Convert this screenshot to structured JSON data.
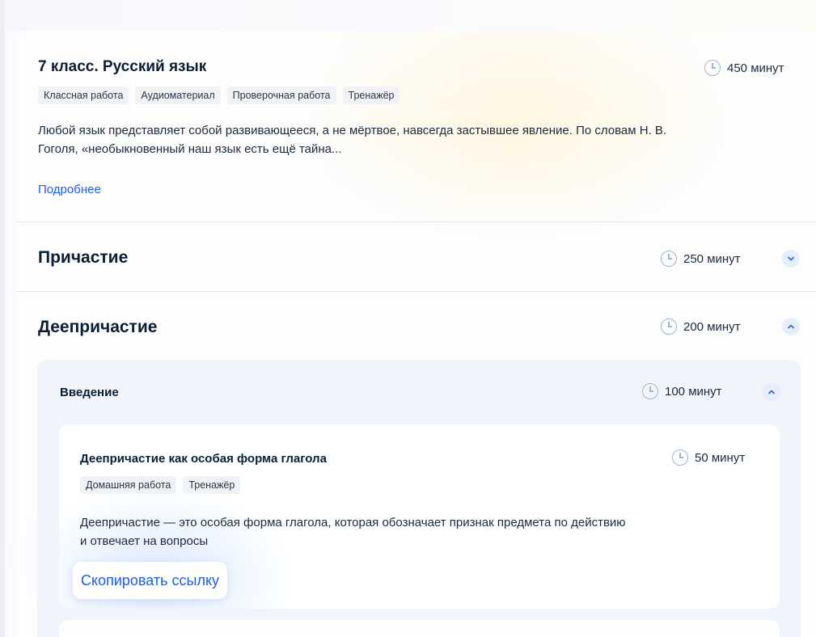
{
  "course": {
    "title": "7 класс. Русский язык",
    "duration": "450 минут",
    "tags": [
      "Классная работа",
      "Аудиоматериал",
      "Проверочная работа",
      "Тренажёр"
    ],
    "description_line1": "Любой язык представляет собой развивающееся, а не мёртвое, навсегда застывшее явление. По словам Н. В.",
    "description_line2": "Гоголя, «необыкновенный наш язык есть ещё тайна...",
    "more_link": "Подробнее"
  },
  "sections": [
    {
      "title": "Причастие",
      "duration": "250 минут",
      "expanded": false
    },
    {
      "title": "Деепричастие",
      "duration": "200 минут",
      "expanded": true,
      "subsections": [
        {
          "title": "Введение",
          "duration": "100 минут",
          "expanded": true,
          "lessons": [
            {
              "title": "Деепричастие как особая форма глагола",
              "duration": "50 минут",
              "tags": [
                "Домашняя работа",
                "Тренажёр"
              ],
              "description_line1": "Деепричастие — это особая форма глагола, которая обозначает признак предмета по действию",
              "description_line2": "и отвечает на вопросы",
              "copy_link_label": "Скопировать ссылку"
            }
          ]
        }
      ]
    }
  ],
  "icons": {
    "duration": "clock-icon",
    "collapsed": "chevron-down-icon",
    "expanded": "chevron-up-icon"
  },
  "colors": {
    "accent": "#1d5deb",
    "title": "#0b1f33",
    "chevron_bg": "#e6eefb",
    "tag_bg": "#f0f2f6",
    "panel_bg": "#f1f4fa"
  }
}
